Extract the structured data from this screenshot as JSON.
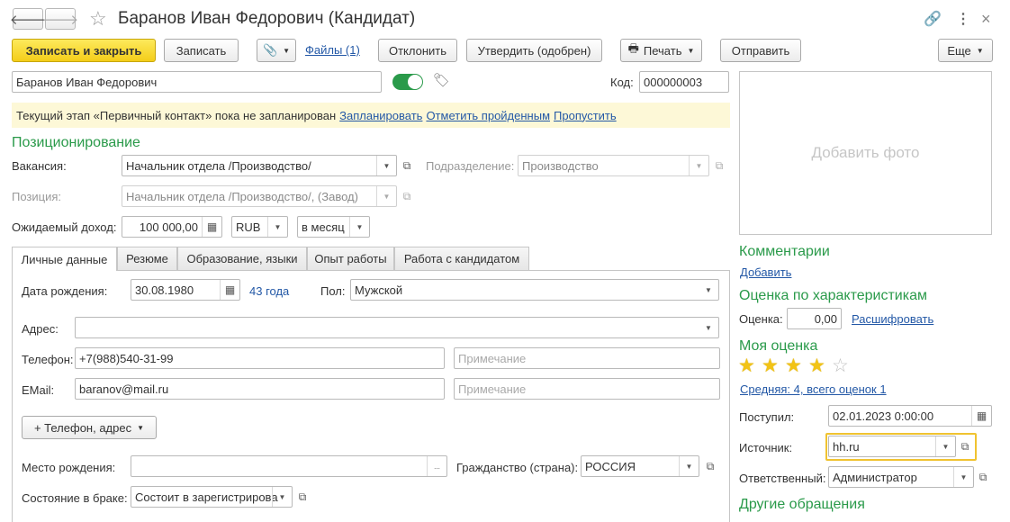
{
  "window": {
    "title": "Баранов Иван Федорович (Кандидат)"
  },
  "icons": {
    "back": "arrow-left-icon",
    "forward": "arrow-right-icon",
    "favorite": "star-outline-icon",
    "link": "link-icon",
    "more": "vertical-dots-icon",
    "close": "close-icon",
    "attach": "paperclip-icon",
    "print": "printer-icon",
    "tag": "tag-icon",
    "calendar": "calendar-icon",
    "open": "open-window-icon"
  },
  "toolbar": {
    "save_close": "Записать и закрыть",
    "save": "Записать",
    "files": "Файлы (1)",
    "reject": "Отклонить",
    "approve": "Утвердить (одобрен)",
    "print": "Печать",
    "send": "Отправить",
    "more": "Еще"
  },
  "candidate": {
    "name": "Баранов Иван Федорович",
    "active_toggle": true,
    "code_label": "Код:",
    "code": "000000003"
  },
  "stage_bar": {
    "text": "Текущий этап «Первичный контакт» пока не запланирован",
    "plan": "Запланировать",
    "mark_done": "Отметить пройденным",
    "skip": "Пропустить"
  },
  "positioning": {
    "title": "Позиционирование",
    "vacancy_label": "Вакансия:",
    "vacancy": "Начальник отдела /Производство/",
    "department_label": "Подразделение:",
    "department": "Производство",
    "position_label": "Позиция:",
    "position": "Начальник отдела /Производство/, (Завод)",
    "income_label": "Ожидаемый доход:",
    "income": "100 000,00",
    "currency": "RUB",
    "period": "в месяц"
  },
  "tabs": [
    {
      "label": "Личные данные",
      "active": true
    },
    {
      "label": "Резюме",
      "active": false
    },
    {
      "label": "Образование, языки",
      "active": false
    },
    {
      "label": "Опыт работы",
      "active": false
    },
    {
      "label": "Работа с кандидатом",
      "active": false
    }
  ],
  "personal": {
    "birth_label": "Дата рождения:",
    "birth_date": "30.08.1980",
    "age": "43 года",
    "gender_label": "Пол:",
    "gender": "Мужской",
    "address_label": "Адрес:",
    "address": "",
    "phone_label": "Телефон:",
    "phone": "+7(988)540-31-99",
    "phone_note_placeholder": "Примечание",
    "email_label": "EMail:",
    "email": "baranov@mail.ru",
    "email_note_placeholder": "Примечание",
    "add_contact": "+ Телефон, адрес",
    "birthplace_label": "Место рождения:",
    "birthplace": "",
    "birthplace_btn": "...",
    "citizenship_label": "Гражданство (страна):",
    "citizenship": "РОССИЯ",
    "marital_label": "Состояние в браке:",
    "marital": "Состоит в зарегистрирова"
  },
  "right_panel": {
    "photo": "Добавить фото",
    "comments_title": "Комментарии",
    "comments_add": "Добавить",
    "rating_title": "Оценка по характеристикам",
    "rating_label": "Оценка:",
    "rating_value": "0,00",
    "rating_decode": "Расшифровать",
    "my_rating_title": "Моя оценка",
    "my_rating_stars": 4,
    "my_rating_max": 5,
    "average": "Средняя: 4, всего оценок 1",
    "received_label": "Поступил:",
    "received": "02.01.2023  0:00:00",
    "source_label": "Источник:",
    "source": "hh.ru",
    "responsible_label": "Ответственный:",
    "responsible": "Администратор",
    "other_title": "Другие обращения"
  },
  "colors": {
    "accent_green": "#2a9a4a",
    "primary_button": "#f4cd19",
    "link": "#2358a6",
    "stage_bar_bg": "#fdf8d7",
    "focus_border": "#f0c330"
  }
}
